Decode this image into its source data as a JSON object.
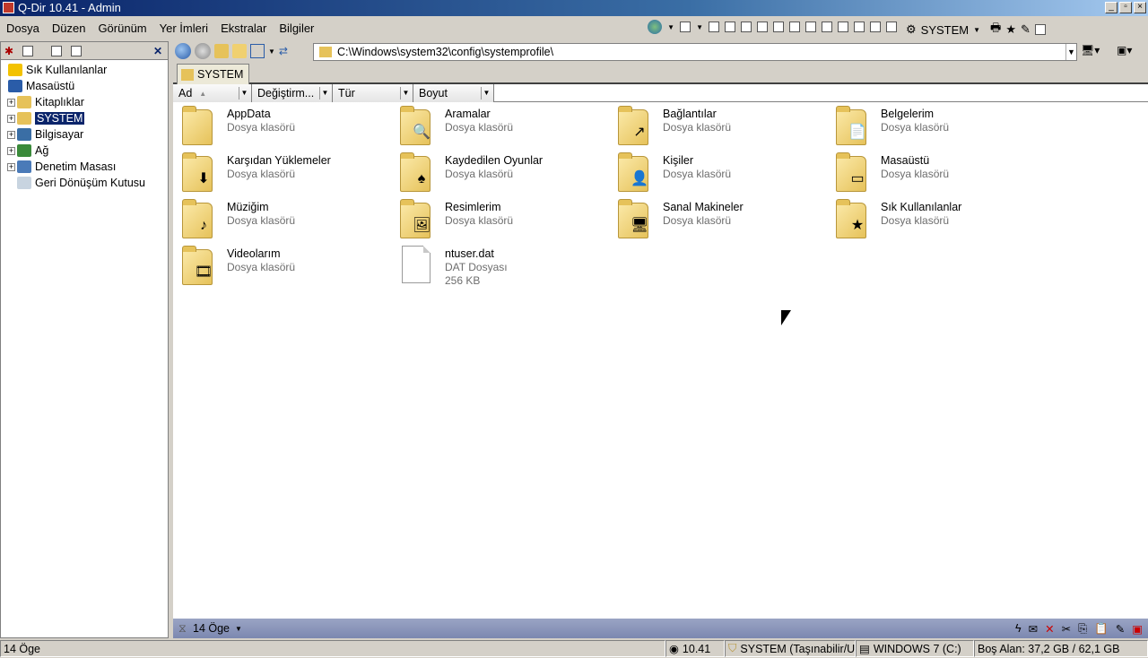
{
  "window": {
    "title": "Q-Dir 10.41 - Admin"
  },
  "menu": [
    "Dosya",
    "Düzen",
    "Görünüm",
    "Yer İmleri",
    "Ekstralar",
    "Bilgiler"
  ],
  "toolbar": {
    "user": "SYSTEM"
  },
  "tree": [
    {
      "label": "Sık Kullanılanlar",
      "expandable": false,
      "selected": false,
      "icon": "star-icon"
    },
    {
      "label": "Masaüstü",
      "expandable": false,
      "selected": false,
      "icon": "desktop-icon"
    },
    {
      "label": "Kitaplıklar",
      "expandable": true,
      "selected": false,
      "icon": "library-icon"
    },
    {
      "label": "SYSTEM",
      "expandable": true,
      "selected": true,
      "icon": "user-folder-icon"
    },
    {
      "label": "Bilgisayar",
      "expandable": true,
      "selected": false,
      "icon": "computer-icon"
    },
    {
      "label": "Ağ",
      "expandable": true,
      "selected": false,
      "icon": "network-icon"
    },
    {
      "label": "Denetim Masası",
      "expandable": true,
      "selected": false,
      "icon": "control-panel-icon"
    },
    {
      "label": "Geri Dönüşüm Kutusu",
      "expandable": false,
      "selected": false,
      "icon": "recycle-bin-icon"
    }
  ],
  "address": {
    "path": "C:\\Windows\\system32\\config\\systemprofile\\"
  },
  "tab": {
    "label": "SYSTEM"
  },
  "columns": [
    "Ad",
    "Değiştirm...",
    "Tür",
    "Boyut"
  ],
  "items": [
    {
      "name": "AppData",
      "type": "Dosya klasörü",
      "badge": "",
      "kind": "folder"
    },
    {
      "name": "Aramalar",
      "type": "Dosya klasörü",
      "badge": "🔍",
      "kind": "folder"
    },
    {
      "name": "Bağlantılar",
      "type": "Dosya klasörü",
      "badge": "↗",
      "kind": "folder"
    },
    {
      "name": "Belgelerim",
      "type": "Dosya klasörü",
      "badge": "📄",
      "kind": "folder"
    },
    {
      "name": "Karşıdan Yüklemeler",
      "type": "Dosya klasörü",
      "badge": "⬇",
      "kind": "folder"
    },
    {
      "name": "Kaydedilen Oyunlar",
      "type": "Dosya klasörü",
      "badge": "♠",
      "kind": "folder"
    },
    {
      "name": "Kişiler",
      "type": "Dosya klasörü",
      "badge": "👤",
      "kind": "folder"
    },
    {
      "name": "Masaüstü",
      "type": "Dosya klasörü",
      "badge": "▭",
      "kind": "folder"
    },
    {
      "name": "Müziğim",
      "type": "Dosya klasörü",
      "badge": "♪",
      "kind": "folder"
    },
    {
      "name": "Resimlerim",
      "type": "Dosya klasörü",
      "badge": "🖼",
      "kind": "folder"
    },
    {
      "name": "Sanal Makineler",
      "type": "Dosya klasörü",
      "badge": "🖥",
      "kind": "folder"
    },
    {
      "name": "Sık Kullanılanlar",
      "type": "Dosya klasörü",
      "badge": "★",
      "kind": "folder"
    },
    {
      "name": "Videolarım",
      "type": "Dosya klasörü",
      "badge": "🎞",
      "kind": "folder"
    },
    {
      "name": "ntuser.dat",
      "type": "DAT Dosyası",
      "size": "256 KB",
      "badge": "",
      "kind": "file"
    }
  ],
  "pane_status": {
    "count": "14 Öge"
  },
  "status": {
    "count": "14 Öge",
    "version": "10.41",
    "user": "SYSTEM (Taşınabilir/U",
    "drive": "WINDOWS 7 (C:)",
    "free": "Boş Alan: 37,2 GB / 62,1 GB"
  }
}
